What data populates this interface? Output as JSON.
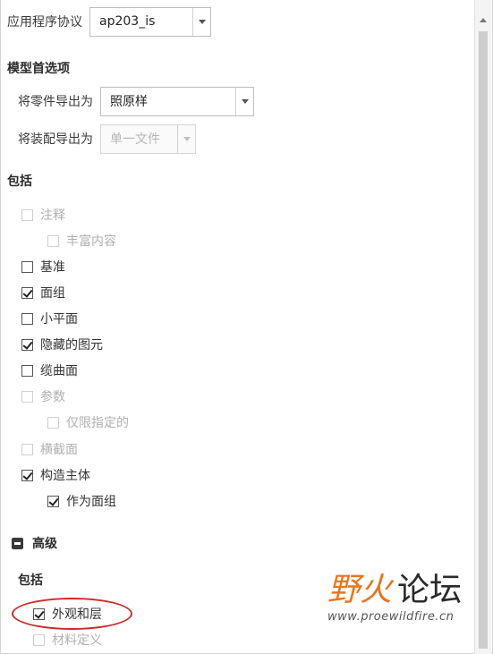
{
  "protocol": {
    "label": "应用程序协议",
    "value": "ap203_is"
  },
  "model_prefs": {
    "heading": "模型首选项",
    "part_export": {
      "label": "将零件导出为",
      "value": "照原样"
    },
    "assembly_export": {
      "label": "将装配导出为",
      "value": "单一文件"
    }
  },
  "include": {
    "heading": "包括",
    "items": [
      {
        "label": "注释",
        "checked": false,
        "enabled": false
      },
      {
        "label": "丰富内容",
        "checked": false,
        "enabled": false
      },
      {
        "label": "基准",
        "checked": false,
        "enabled": true
      },
      {
        "label": "面组",
        "checked": true,
        "enabled": true
      },
      {
        "label": "小平面",
        "checked": false,
        "enabled": true
      },
      {
        "label": "隐藏的图元",
        "checked": true,
        "enabled": true
      },
      {
        "label": "缆曲面",
        "checked": false,
        "enabled": true
      },
      {
        "label": "参数",
        "checked": false,
        "enabled": false
      },
      {
        "label": "仅限指定的",
        "checked": false,
        "enabled": false
      },
      {
        "label": "横截面",
        "checked": false,
        "enabled": false
      },
      {
        "label": "构造主体",
        "checked": true,
        "enabled": true
      },
      {
        "label": "作为面组",
        "checked": true,
        "enabled": true
      }
    ]
  },
  "advanced": {
    "heading": "高级",
    "include_heading": "包括",
    "items": [
      {
        "label": "外观和层",
        "checked": true,
        "enabled": true
      },
      {
        "label": "材料定义",
        "checked": false,
        "enabled": false
      }
    ]
  },
  "watermark": {
    "brand_1": "野",
    "brand_2": "火",
    "brand_3": "论坛",
    "url": "www.proewildfire.cn"
  }
}
